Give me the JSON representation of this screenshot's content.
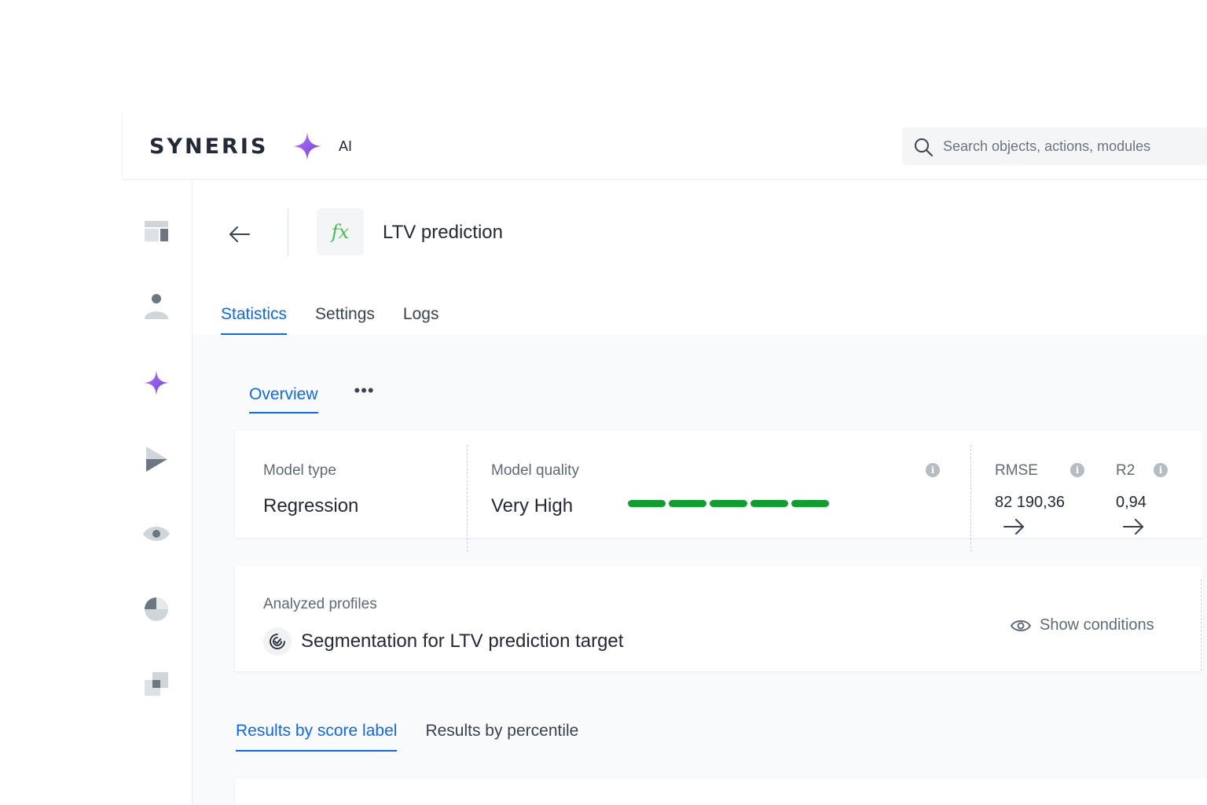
{
  "brand": {
    "logo_text": "SYNERISE",
    "ai_label": "AI"
  },
  "search": {
    "placeholder": "Search objects, actions, modules"
  },
  "sidebar": {
    "items": [
      {
        "icon": "dashboard-icon"
      },
      {
        "icon": "profile-icon"
      },
      {
        "icon": "ai-star-icon",
        "active": true
      },
      {
        "icon": "automation-play-icon"
      },
      {
        "icon": "eye-icon"
      },
      {
        "icon": "analytics-pie-icon"
      },
      {
        "icon": "assets-icon"
      }
    ]
  },
  "page": {
    "title": "LTV prediction",
    "icon_text": "fx"
  },
  "tabs": [
    {
      "label": "Statistics",
      "active": true
    },
    {
      "label": "Settings",
      "active": false
    },
    {
      "label": "Logs",
      "active": false
    }
  ],
  "subtabs": {
    "overview_label": "Overview",
    "more_label": "•••"
  },
  "stats": {
    "model_type_label": "Model type",
    "model_type_value": "Regression",
    "model_quality_label": "Model quality",
    "model_quality_value": "Very High",
    "quality_level": 5,
    "quality_max": 5,
    "rmse_label": "RMSE",
    "rmse_value": "82 190,36",
    "r2_label": "R2",
    "r2_value": "0,94",
    "info_glyph": "i"
  },
  "profiles": {
    "label": "Analyzed profiles",
    "segment_name": "Segmentation for LTV prediction target",
    "show_conditions_label": "Show conditions"
  },
  "result_tabs": [
    {
      "label": "Results by score label",
      "active": true
    },
    {
      "label": "Results by percentile",
      "active": false
    }
  ],
  "colors": {
    "accent": "#0b68ff",
    "quality_green": "#0e9f2e",
    "ai_purple": "#8a4fff",
    "fx_green": "#47c147"
  }
}
